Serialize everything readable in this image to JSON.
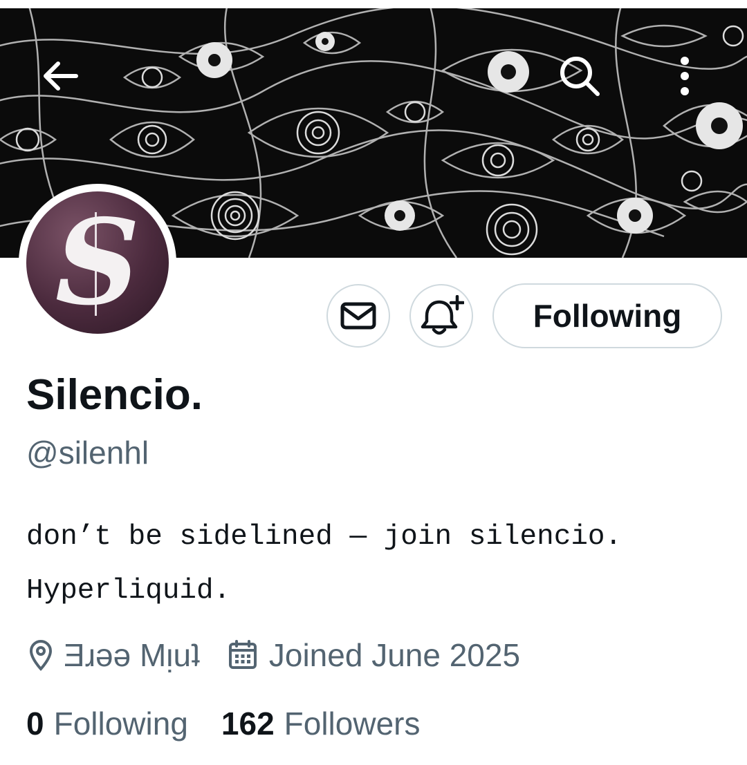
{
  "header": {
    "back_icon": "arrow-left-icon",
    "search_icon": "search-icon",
    "more_icon": "more-vertical-icon"
  },
  "profile": {
    "avatar_letter": "S",
    "display_name": "Silencio.",
    "handle": "@silenhl",
    "bio_lines": [
      "don’t be sidelined — join silencio.",
      "Hyperliquid."
    ],
    "location": "Ǝɹǝǝ Mᴉuʇ",
    "joined": "Joined June 2025"
  },
  "actions": {
    "message_icon": "envelope-icon",
    "notify_icon": "bell-plus-icon",
    "follow_label": "Following"
  },
  "stats": {
    "following_count": "0",
    "following_label": "Following",
    "followers_count": "162",
    "followers_label": "Followers"
  },
  "colors": {
    "text_primary": "#0f1419",
    "text_secondary": "#536471",
    "border": "#cfd9de",
    "banner_bg": "#0b0b0b",
    "avatar_bg": "#4b2a3d"
  }
}
